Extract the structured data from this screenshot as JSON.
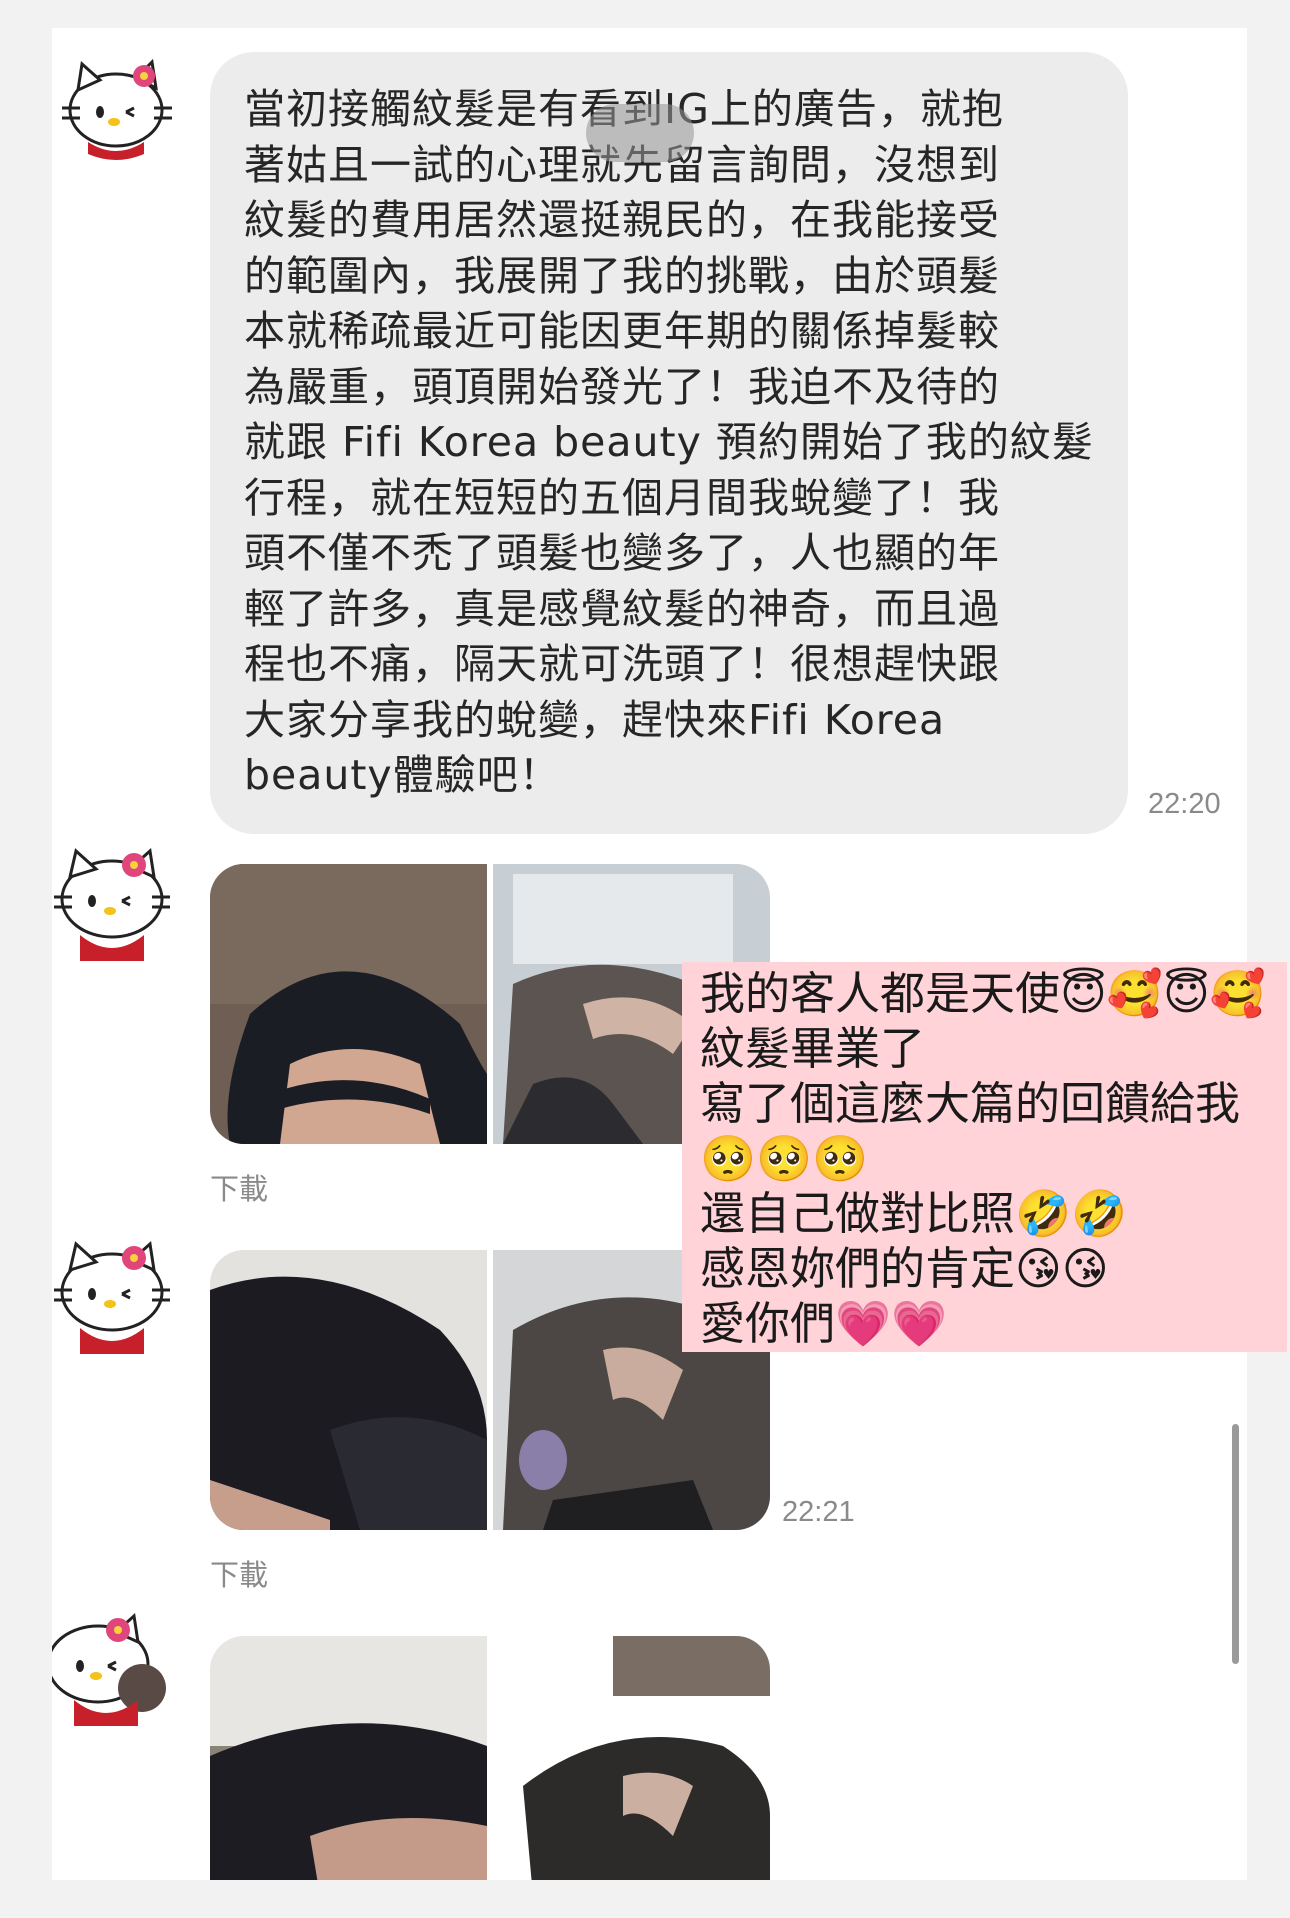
{
  "messages": [
    {
      "type": "text",
      "text": "當初接觸紋髮是有看到IG上的廣告，就抱\n著姑且一試的心理就先留言詢問，沒想到\n紋髮的費用居然還挺親民的，在我能接受\n的範圍內，我展開了我的挑戰，由於頭髮\n本就稀疏最近可能因更年期的關係掉髮較\n為嚴重，頭頂開始發光了！我迫不及待的\n就跟 Fifi Korea beauty 預約開始了我的紋髮\n行程，就在短短的五個月間我蛻變了！我\n頭不僅不禿了頭髮也變多了，人也顯的年\n輕了許多，真是感覺紋髮的神奇，而且過\n程也不痛，隔天就可洗頭了！很想趕快跟\n大家分享我的蛻變，趕快來Fifi Korea\nbeauty體驗吧！",
      "time": "22:20"
    },
    {
      "type": "photos",
      "download_label": "下載"
    },
    {
      "type": "photos",
      "download_label": "下載",
      "time": "22:21"
    },
    {
      "type": "photos"
    }
  ],
  "overlay_caption": [
    "我的客人都是天使😇🥰😇🥰",
    "紋髮畢業了",
    "寫了個這麼大篇的回饋給我",
    "🥺🥺🥺",
    "還自己做對比照🤣🤣",
    "感恩妳們的肯定😘😘",
    "愛你們💗💗"
  ],
  "colors": {
    "bubble": "#ececec",
    "overlay": "#ffd3d8",
    "time": "#8a8a8a"
  },
  "icons": [
    "hello-kitty-avatar-icon"
  ]
}
